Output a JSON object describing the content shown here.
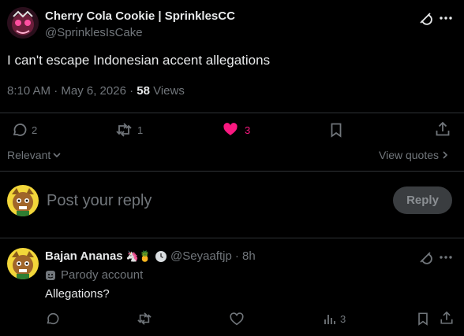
{
  "tweet": {
    "author_name": "Cherry Cola Cookie | SprinklesCC",
    "author_handle": "@SprinklesIsCake",
    "text": "I can't escape Indonesian accent allegations",
    "time": "8:10 AM · May 6, 2026 · ",
    "views_count": "58",
    "views_label": " Views",
    "replies": "2",
    "reposts": "1",
    "likes": "3",
    "like_color": "#f91880"
  },
  "filters": {
    "sort_label": "Relevant",
    "view_quotes": "View quotes"
  },
  "composer": {
    "placeholder": "Post your reply",
    "reply_button": "Reply"
  },
  "reply": {
    "author_name": "Bajan Ananas",
    "author_emoji": "🦄🍍",
    "author_handle": "@Seyaaftjp",
    "time": " · 8h",
    "parody_label": "Parody account",
    "text": "Allegations?",
    "views": "3"
  }
}
